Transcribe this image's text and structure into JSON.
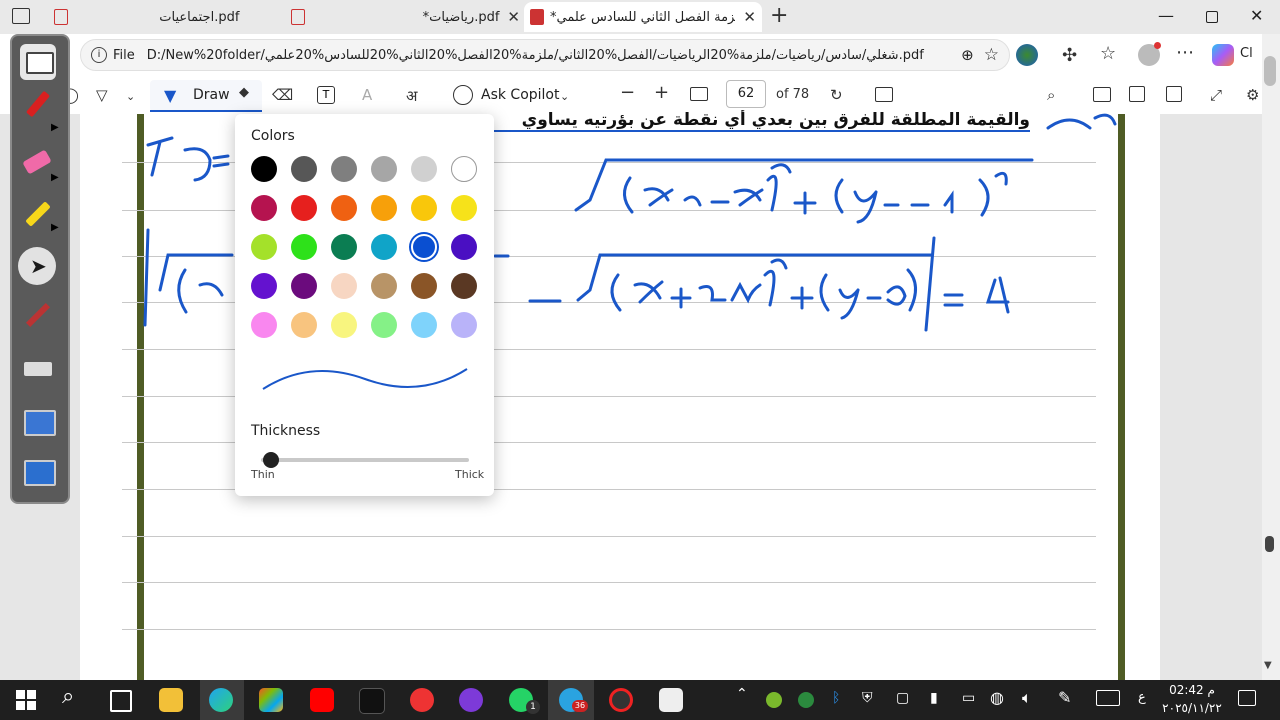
{
  "browser": {
    "tabs": [
      {
        "label": "اجتماعيات.pdf",
        "active": false
      },
      {
        "label": "*رياضيات.pdf",
        "active": false
      },
      {
        "label": "*ملزمة الفصل الثاني للسادس علمي",
        "active": true
      }
    ],
    "new_tab_icon": "plus-icon",
    "address_label": "File",
    "url": "D:/New%20folder/شغلي/سادس/رياضيات/ملزمة%20الرياضيات/الفصل%20الثاني/ملزمة%20الفصل%20الثاني%20للسادس%20علمي.pdf",
    "copilot_partial": "Cl"
  },
  "pdf_toolbar": {
    "draw_label": "Draw",
    "copilot_label": "Ask Copilot",
    "page_number": "62",
    "page_total": "of 78"
  },
  "draw_popup": {
    "colors_title": "Colors",
    "thickness_title": "Thickness",
    "thin_label": "Thin",
    "thick_label": "Thick",
    "selected_color": "#0a4fd1",
    "colors": [
      [
        "#000000",
        "#575757",
        "#7f7f7f",
        "#a6a6a6",
        "#d0d0d0",
        "#ffffff"
      ],
      [
        "#b5134f",
        "#e6201e",
        "#ef6112",
        "#f7a00a",
        "#f9c70b",
        "#f6e21a"
      ],
      [
        "#a4e12a",
        "#2ee11a",
        "#0b7d52",
        "#10a4c8",
        "#0a4fd1",
        "#4a0fc2"
      ],
      [
        "#6412cf",
        "#6b0b7d",
        "#f7d6c2",
        "#b89467",
        "#8a5527",
        "#5a3823"
      ],
      [
        "#f987ef",
        "#f8c47f",
        "#f8f57f",
        "#85f187",
        "#7fd3fb",
        "#b9b3f9"
      ]
    ],
    "thickness": 0.05
  },
  "page_text": {
    "header_partial": "والقيمة المطلقة للفرق بين بعدي أي نقطة عن بؤرتيه يساوي"
  },
  "taskbar": {
    "time": "02:42 م",
    "date": "٢٠٢٥/١١/٢٢",
    "lang": "ع",
    "telegram_badge": "36",
    "whatsapp_badge": "1"
  }
}
